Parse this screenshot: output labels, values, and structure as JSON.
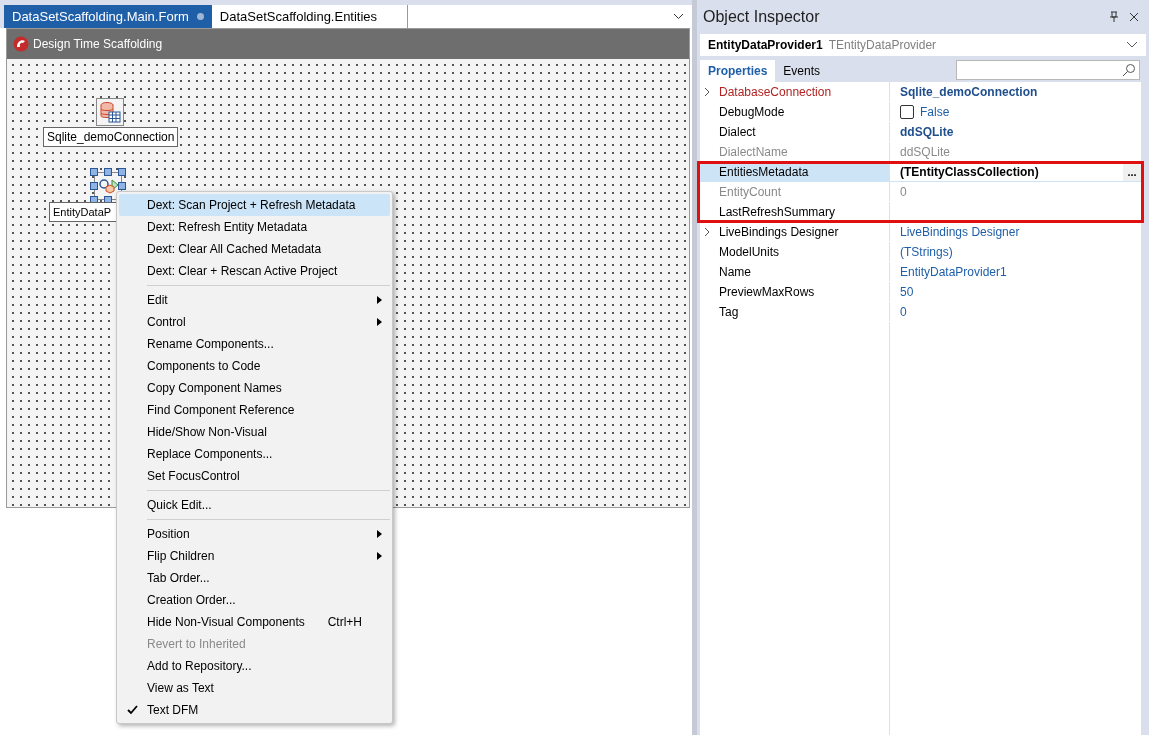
{
  "editor_tabs": [
    {
      "label": "DataSetScaffolding.Main.Form",
      "selected": true,
      "modified": true
    },
    {
      "label": "DataSetScaffolding.Entities",
      "selected": false,
      "modified": false
    }
  ],
  "form": {
    "title": "Design Time Scaffolding",
    "components": [
      {
        "kind": "database",
        "label": "Sqlite_demoConnection",
        "selected": false
      },
      {
        "kind": "provider",
        "label": "EntityDataP",
        "selected": true
      }
    ]
  },
  "context_menu": [
    {
      "kind": "item",
      "label": "Dext: Scan Project + Refresh Metadata",
      "selected": true
    },
    {
      "kind": "item",
      "label": "Dext: Refresh Entity Metadata",
      "selected": false
    },
    {
      "kind": "item",
      "label": "Dext: Clear All Cached Metadata",
      "selected": false
    },
    {
      "kind": "item",
      "label": "Dext: Clear + Rescan Active Project",
      "selected": false
    },
    {
      "kind": "separator"
    },
    {
      "kind": "item",
      "label": "Edit",
      "submenu": true,
      "selected": false
    },
    {
      "kind": "item",
      "label": "Control",
      "submenu": true,
      "selected": false
    },
    {
      "kind": "item",
      "label": "Rename Components...",
      "selected": false
    },
    {
      "kind": "item",
      "label": "Components to Code",
      "selected": false
    },
    {
      "kind": "item",
      "label": "Copy Component Names",
      "selected": false
    },
    {
      "kind": "item",
      "label": "Find Component Reference",
      "selected": false
    },
    {
      "kind": "item",
      "label": "Hide/Show Non-Visual",
      "selected": false
    },
    {
      "kind": "item",
      "label": "Replace Components...",
      "selected": false
    },
    {
      "kind": "item",
      "label": "Set FocusControl",
      "selected": false
    },
    {
      "kind": "separator"
    },
    {
      "kind": "item",
      "label": "Quick Edit...",
      "selected": false
    },
    {
      "kind": "separator"
    },
    {
      "kind": "item",
      "label": "Position",
      "submenu": true,
      "selected": false
    },
    {
      "kind": "item",
      "label": "Flip Children",
      "submenu": true,
      "selected": false
    },
    {
      "kind": "item",
      "label": "Tab Order...",
      "selected": false
    },
    {
      "kind": "item",
      "label": "Creation Order...",
      "selected": false
    },
    {
      "kind": "item",
      "label": "Hide Non-Visual Components",
      "shortcut": "Ctrl+H",
      "selected": false
    },
    {
      "kind": "item",
      "label": "Revert to Inherited",
      "disabled": true,
      "selected": false
    },
    {
      "kind": "item",
      "label": "Add to Repository...",
      "selected": false
    },
    {
      "kind": "item",
      "label": "View as Text",
      "selected": false
    },
    {
      "kind": "item",
      "label": "Text DFM",
      "checked": true,
      "selected": false
    }
  ],
  "object_inspector": {
    "title": "Object Inspector",
    "object_name": "EntityDataProvider1",
    "object_type": "TEntityDataProvider",
    "tabs": [
      {
        "label": "Properties",
        "selected": true
      },
      {
        "label": "Events",
        "selected": false
      }
    ],
    "properties": [
      {
        "name": "DatabaseConnection",
        "value": "Sqlite_demoConnection",
        "reference": true,
        "read_only": false,
        "modified": true,
        "expandable": true,
        "selected": false,
        "highlighted": false
      },
      {
        "name": "DebugMode",
        "value": "False",
        "checked": false,
        "reference": false,
        "read_only": false,
        "modified": false,
        "expandable": false,
        "selected": false,
        "highlighted": false
      },
      {
        "name": "Dialect",
        "value": "ddSQLite",
        "reference": false,
        "read_only": false,
        "modified": true,
        "expandable": false,
        "selected": false,
        "highlighted": false
      },
      {
        "name": "DialectName",
        "value": "ddSQLite",
        "reference": false,
        "read_only": true,
        "modified": false,
        "expandable": false,
        "selected": false,
        "highlighted": false
      },
      {
        "name": "EntitiesMetadata",
        "value": "(TEntityClassCollection)",
        "button": "...",
        "reference": false,
        "read_only": false,
        "modified": true,
        "expandable": false,
        "selected": true,
        "highlighted": true
      },
      {
        "name": "EntityCount",
        "value": "0",
        "reference": false,
        "read_only": true,
        "modified": false,
        "expandable": false,
        "selected": false,
        "highlighted": true
      },
      {
        "name": "LastRefreshSummary",
        "reference": false,
        "read_only": false,
        "expandable": false,
        "selected": false,
        "highlighted": true
      },
      {
        "name": "LiveBindings Designer",
        "value": "LiveBindings Designer",
        "reference": false,
        "read_only": false,
        "modified": false,
        "expandable": true,
        "selected": false,
        "highlighted": false
      },
      {
        "name": "ModelUnits",
        "value": "(TStrings)",
        "reference": false,
        "read_only": false,
        "modified": false,
        "expandable": false,
        "selected": false,
        "highlighted": false
      },
      {
        "name": "Name",
        "value": "EntityDataProvider1",
        "reference": false,
        "read_only": false,
        "modified": false,
        "expandable": false,
        "selected": false,
        "highlighted": false
      },
      {
        "name": "PreviewMaxRows",
        "value": "50",
        "reference": false,
        "read_only": false,
        "modified": false,
        "expandable": false,
        "selected": false,
        "highlighted": false
      },
      {
        "name": "Tag",
        "value": "0",
        "reference": false,
        "read_only": false,
        "modified": false,
        "expandable": false,
        "selected": false,
        "highlighted": false
      }
    ]
  }
}
